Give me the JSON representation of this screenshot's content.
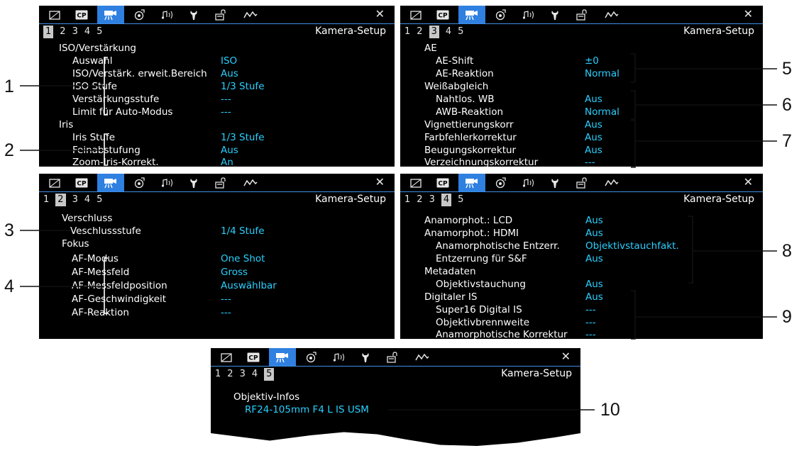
{
  "header_title": "Kamera-Setup",
  "close_glyph": "✕",
  "tab_icons": [
    "film-icon",
    "cp-icon",
    "camera-icon",
    "color-icon",
    "audio-icon",
    "wrench-icon",
    "lock-icon",
    "wave-icon"
  ],
  "accent_color": "#2f80e0",
  "value_color": "#2ad0ff",
  "screens": {
    "s1": {
      "pages": [
        "1",
        "2",
        "3",
        "4",
        "5"
      ],
      "current_page": 1,
      "rows": [
        {
          "label": "ISO/Verstärkung",
          "value": ""
        },
        {
          "label": "Auswahl",
          "value": "ISO"
        },
        {
          "label": "ISO/Verstärk. erweit.Bereich",
          "value": "Aus"
        },
        {
          "label": "ISO Stufe",
          "value": "1/3 Stufe"
        },
        {
          "label": "Verstärkungsstufe",
          "value": "---"
        },
        {
          "label": "Limit für Auto-Modus",
          "value": "---"
        },
        {
          "label": "Iris",
          "value": ""
        },
        {
          "label": "Iris Stufe",
          "value": "1/3 Stufe"
        },
        {
          "label": "Feinabstufung",
          "value": "Aus"
        },
        {
          "label": "Zoom-Iris-Korrekt.",
          "value": "An"
        }
      ]
    },
    "s2": {
      "pages": [
        "1",
        "2",
        "3",
        "4",
        "5"
      ],
      "current_page": 2,
      "rows": [
        {
          "label": "Verschluss",
          "value": ""
        },
        {
          "label": "Veschlussstufe",
          "value": "1/4 Stufe"
        },
        {
          "label": "Fokus",
          "value": ""
        },
        {
          "label": "AF-Modus",
          "value": "One Shot"
        },
        {
          "label": "AF-Messfeld",
          "value": "Gross"
        },
        {
          "label": "AF-Messfeldposition",
          "value": "Auswählbar"
        },
        {
          "label": "AF-Geschwindigkeit",
          "value": "---"
        },
        {
          "label": "AF-Reaktion",
          "value": "---"
        }
      ]
    },
    "s3": {
      "pages": [
        "1",
        "2",
        "3",
        "4",
        "5"
      ],
      "current_page": 3,
      "rows": [
        {
          "label": "AE",
          "value": ""
        },
        {
          "label": "AE-Shift",
          "value": "±0"
        },
        {
          "label": "AE-Reaktion",
          "value": "Normal"
        },
        {
          "label": "Weißabgleich",
          "value": ""
        },
        {
          "label": "Nahtlos. WB",
          "value": "Aus"
        },
        {
          "label": "AWB-Reaktion",
          "value": "Normal"
        },
        {
          "label": "Vignettierungskorr",
          "value": "Aus"
        },
        {
          "label": "Farbfehlerkorrektur",
          "value": "Aus"
        },
        {
          "label": "Beugungskorrektur",
          "value": "Aus"
        },
        {
          "label": "Verzeichnungskorrektur",
          "value": "---"
        }
      ]
    },
    "s4": {
      "pages": [
        "1",
        "2",
        "3",
        "4",
        "5"
      ],
      "current_page": 4,
      "rows": [
        {
          "label": "Anamorphot.: LCD",
          "value": "Aus"
        },
        {
          "label": "Anamorphot.: HDMI",
          "value": "Aus"
        },
        {
          "label": "Anamorphotische Entzerr.",
          "value": "Objektivstauchfakt."
        },
        {
          "label": "Entzerrung für S&F",
          "value": "Aus"
        },
        {
          "label": "Metadaten",
          "value": ""
        },
        {
          "label": "Objektivstauchung",
          "value": "Aus"
        },
        {
          "label": "Digitaler IS",
          "value": "Aus"
        },
        {
          "label": "Super16 Digital IS",
          "value": "---"
        },
        {
          "label": "Objektivbrennweite",
          "value": "---"
        },
        {
          "label": "Anamorphotische Korrektur",
          "value": "---"
        }
      ]
    },
    "s5": {
      "pages": [
        "1",
        "2",
        "3",
        "4",
        "5"
      ],
      "current_page": 5,
      "rows": [
        {
          "label": "Objektiv-Infos",
          "value": ""
        },
        {
          "label": "",
          "value": "RF24-105mm F4 L IS USM"
        }
      ]
    }
  },
  "callouts": [
    "1",
    "2",
    "3",
    "4",
    "5",
    "6",
    "7",
    "8",
    "9",
    "10"
  ]
}
